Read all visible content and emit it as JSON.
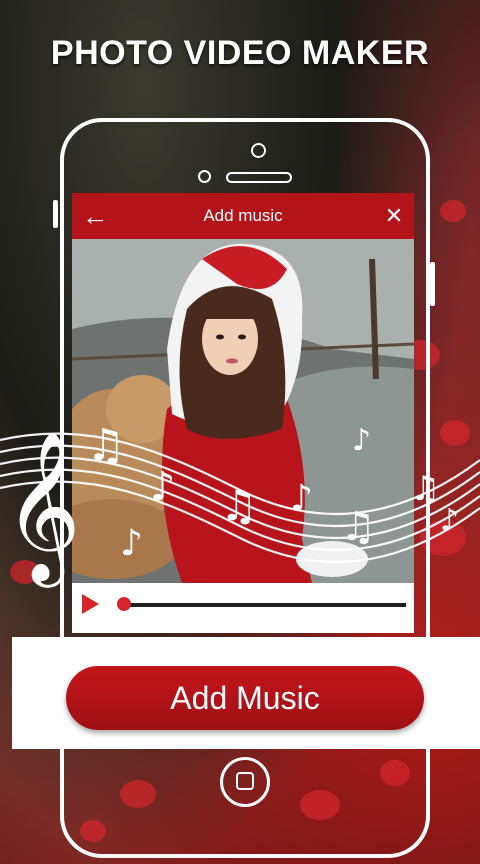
{
  "headline": "PHOTO VIDEO MAKER",
  "screen": {
    "title": "Add music",
    "back_icon": "arrow-left-icon",
    "close_icon": "close-icon",
    "playback_progress_fraction": 0.02
  },
  "cta": {
    "label": "Add Music"
  },
  "colors": {
    "accent": "#b3141a",
    "player_red": "#d8242a"
  }
}
